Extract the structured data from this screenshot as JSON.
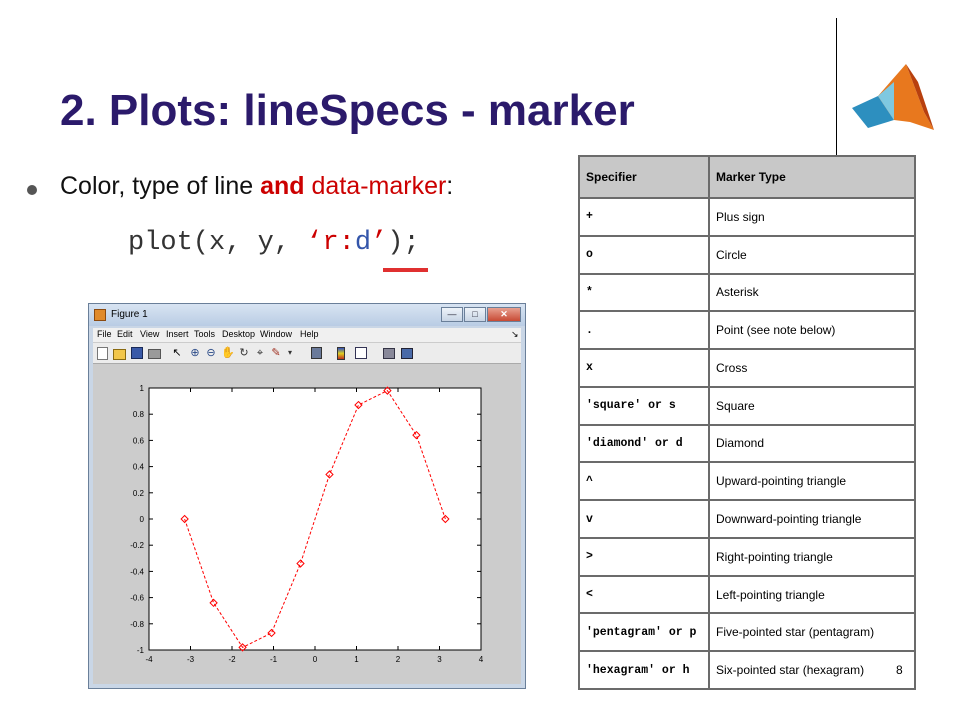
{
  "slide": {
    "title": "2. Plots: lineSpecs - marker",
    "bullet": {
      "part1": "Color, type of line ",
      "and": "and",
      "part2": " ",
      "red_text": "data-marker",
      "colon": ":"
    },
    "code": {
      "prefix": "plot(x, y, ",
      "open": "‘",
      "r": "r",
      "colon": ":",
      "d": "d",
      "close": "’",
      "suffix": ");"
    },
    "page_number": "8",
    "logo": "matlab-logo-icon"
  },
  "figure_window": {
    "title": "Figure 1",
    "window_buttons": [
      "minimize",
      "maximize",
      "close"
    ],
    "menu": [
      "File",
      "Edit",
      "View",
      "Insert",
      "Tools",
      "Desktop",
      "Window",
      "Help"
    ],
    "toolbar_icons": [
      "new-figure-icon",
      "open-icon",
      "save-icon",
      "print-icon",
      "arrow-icon",
      "zoom-in-icon",
      "zoom-out-icon",
      "pan-icon",
      "rotate-icon",
      "data-cursor-icon",
      "brush-icon",
      "link-icon",
      "colorbar-icon",
      "legend-icon",
      "hide-plot-tools-icon",
      "show-plot-tools-icon"
    ]
  },
  "chart_data": {
    "type": "line",
    "line_style": "dotted",
    "marker": "diamond",
    "color": "#ff0000",
    "x": [
      -3.1416,
      -2.4435,
      -1.7453,
      -1.0472,
      -0.3491,
      0.3491,
      1.0472,
      1.7453,
      2.4435,
      3.1416
    ],
    "y": [
      0,
      -0.64,
      -0.98,
      -0.87,
      -0.34,
      0.34,
      0.87,
      0.98,
      0.64,
      0
    ],
    "xlim": [
      -4,
      4
    ],
    "ylim": [
      -1,
      1
    ],
    "xticks": [
      "-4",
      "-3",
      "-2",
      "-1",
      "0",
      "1",
      "2",
      "3",
      "4"
    ],
    "yticks": [
      "-1",
      "-0.8",
      "-0.6",
      "-0.4",
      "-0.2",
      "0",
      "0.2",
      "0.4",
      "0.6",
      "0.8",
      "1"
    ],
    "grid": false
  },
  "marker_table": {
    "headers": [
      "Specifier",
      "Marker Type"
    ],
    "rows": [
      {
        "spec": "+",
        "desc": "Plus sign"
      },
      {
        "spec": "o",
        "desc": "Circle"
      },
      {
        "spec": "*",
        "desc": "Asterisk"
      },
      {
        "spec": ".",
        "desc": "Point (see note below)"
      },
      {
        "spec": "x",
        "desc": "Cross"
      },
      {
        "spec": "'square' or s",
        "desc": "Square"
      },
      {
        "spec": "'diamond' or d",
        "desc": "Diamond"
      },
      {
        "spec": "^",
        "desc": "Upward-pointing triangle"
      },
      {
        "spec": "v",
        "desc": "Downward-pointing triangle"
      },
      {
        "spec": ">",
        "desc": "Right-pointing triangle"
      },
      {
        "spec": "<",
        "desc": "Left-pointing triangle"
      },
      {
        "spec": "'pentagram' or p",
        "desc": "Five-pointed star (pentagram)"
      },
      {
        "spec": "'hexagram' or h",
        "desc": "Six-pointed star (hexagram)"
      }
    ]
  }
}
